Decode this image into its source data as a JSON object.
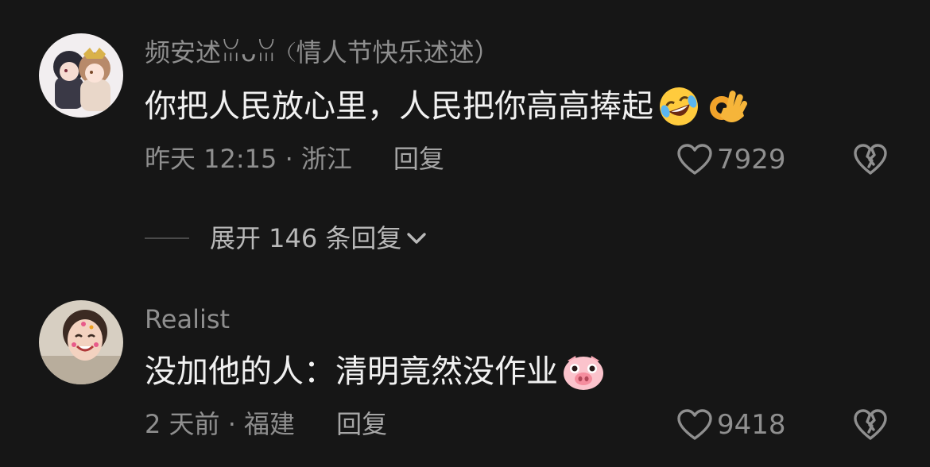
{
  "comments": [
    {
      "username": "频安述ꈍᴗꈍ（情人节快乐述述）",
      "text": "你把人民放心里，人民把你高高捧起",
      "emojis": [
        "rolling-laughing-emoji",
        "ok-hand-emoji"
      ],
      "time_location": "昨天 12:15 · 浙江",
      "reply_label": "回复",
      "likes": "7929"
    },
    {
      "username": "Realist",
      "text": "没加他的人：清明竟然没作业",
      "emojis": [
        "pig-face-emoji"
      ],
      "time_location": "2 天前 · 福建",
      "reply_label": "回复",
      "likes": "9418"
    }
  ],
  "expand_replies": {
    "label": "展开 146 条回复"
  },
  "icons": {
    "like": "heart-outline-icon",
    "dislike": "broken-heart-icon",
    "expand": "chevron-down-icon"
  },
  "colors": {
    "background": "#161616",
    "primary_text": "#f1f1f1",
    "secondary_text": "#8f8f8f"
  }
}
